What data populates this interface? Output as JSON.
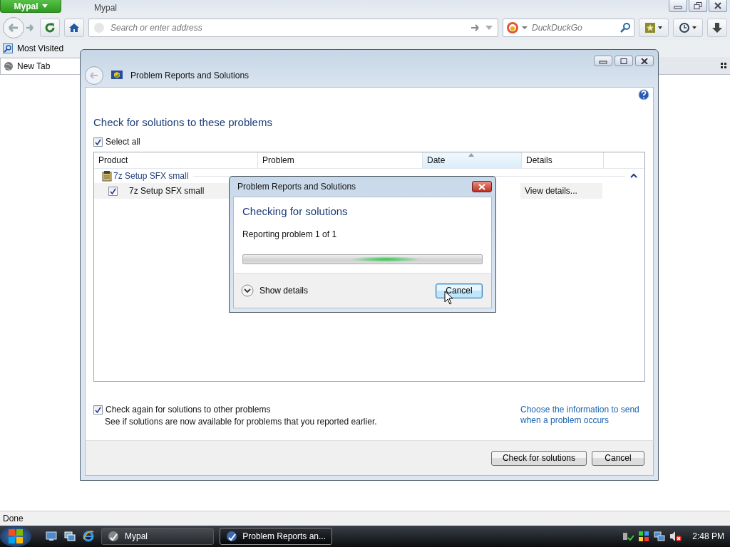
{
  "browser": {
    "app_menu": "Mypal",
    "title": "Mypal",
    "address_placeholder": "Search or enter address",
    "search_placeholder": "DuckDuckGo",
    "bookmarks": [
      "Most Visited"
    ],
    "tabs": [
      {
        "label": "New Tab",
        "selected": true
      }
    ],
    "status": "Done"
  },
  "window": {
    "title": "Problem Reports and Solutions",
    "heading": "Check for solutions to these problems",
    "select_all": {
      "label": "Select all",
      "checked": true
    },
    "table": {
      "columns": [
        {
          "label": "Product",
          "sorted": false
        },
        {
          "label": "Problem",
          "sorted": false
        },
        {
          "label": "Date",
          "sorted": true
        },
        {
          "label": "Details",
          "sorted": false
        }
      ],
      "groups": [
        {
          "name": "7z Setup SFX small",
          "expanded": true,
          "rows": [
            {
              "checked": true,
              "product": "7z Setup SFX small",
              "details": "View details..."
            }
          ]
        }
      ]
    },
    "check_again": {
      "label": "Check again for solutions to other problems",
      "checked": true,
      "description": "See if solutions are now available for problems that you reported earlier."
    },
    "link": "Choose the information to send when a problem occurs",
    "buttons": [
      "Check for solutions",
      "Cancel"
    ]
  },
  "dialog": {
    "title": "Problem Reports and Solutions",
    "heading": "Checking for solutions",
    "status": "Reporting problem 1 of 1",
    "progress": {
      "indeterminate": true
    },
    "details_toggle": "Show details",
    "button": "Cancel"
  },
  "taskbar": {
    "items": [
      {
        "label": "Mypal",
        "selected": false
      },
      {
        "label": "Problem Reports an...",
        "selected": true
      }
    ],
    "clock": "2:48 PM"
  }
}
